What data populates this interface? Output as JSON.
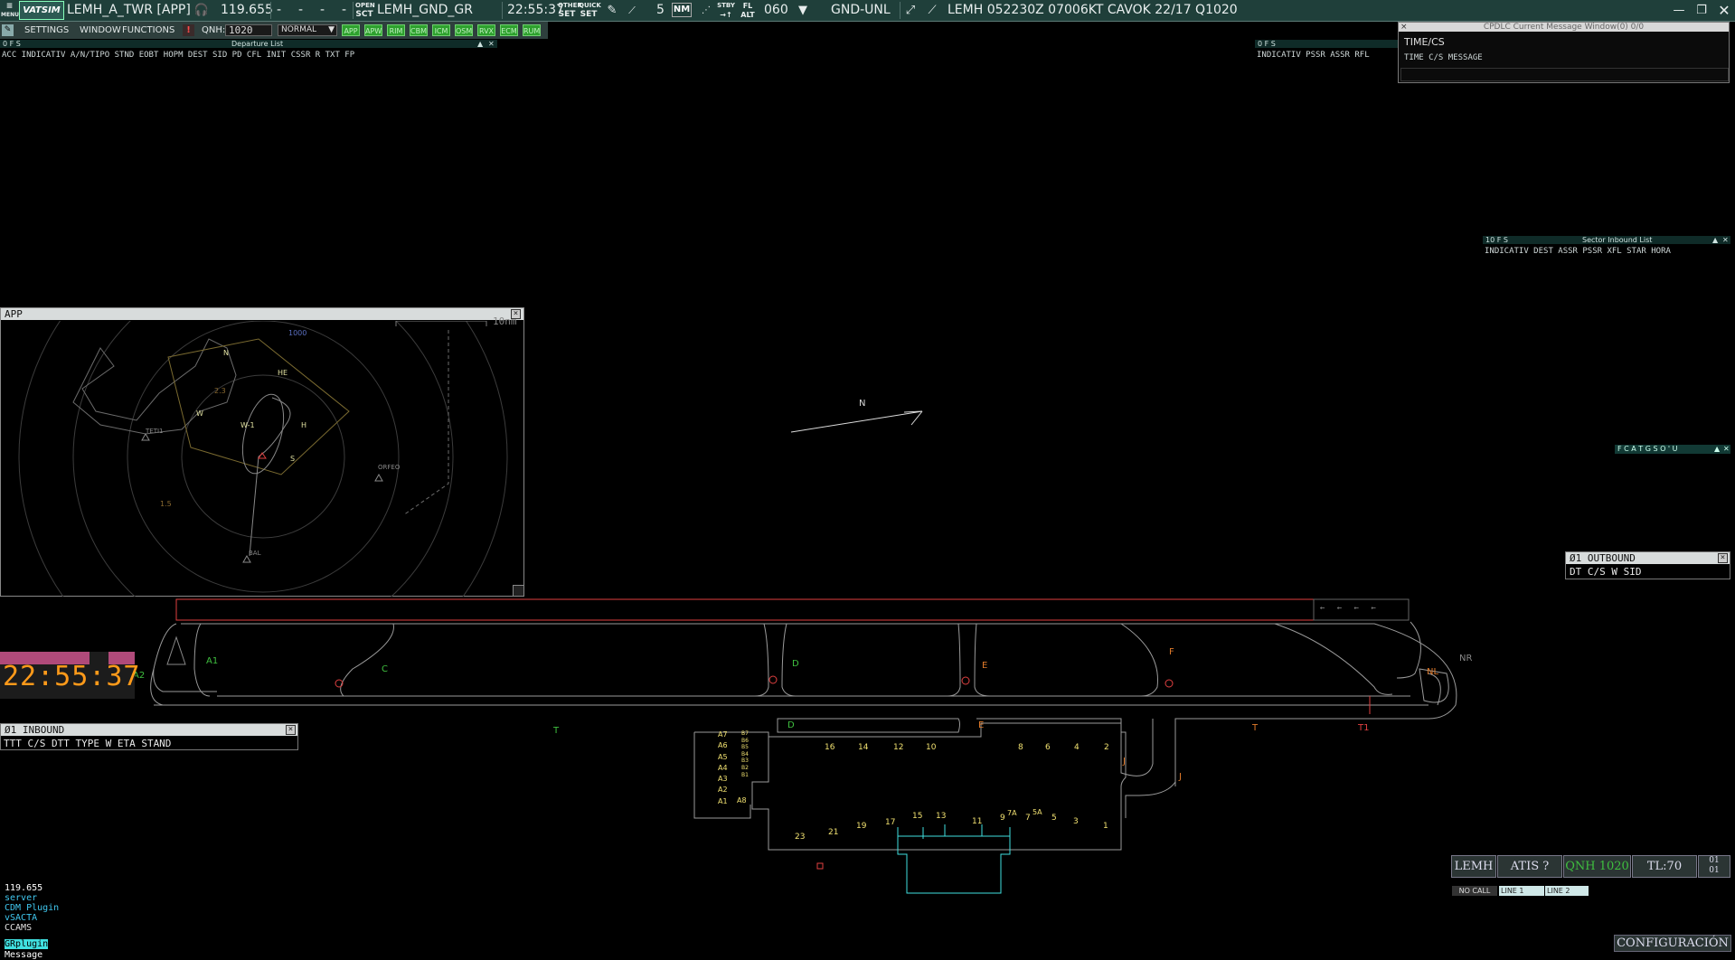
{
  "topbar": {
    "menu_label": "MENU",
    "logo": "VATSIM",
    "callsign": "LEMH_A_TWR [APP]",
    "frequency": "119.655",
    "dashes": [
      "-",
      "-",
      "-",
      "-"
    ],
    "open_label": "OPEN",
    "sct_label": "SCT",
    "gnd_station": "LEMH_GND_GR",
    "utc_time": "22:55:37",
    "other_set": "OTHER",
    "set_label": "SET",
    "quick_set": "QUICK",
    "range_value": "5",
    "nm_label": "NM",
    "stby_label": "STBY",
    "fl_label": "FL",
    "alt_label": "ALT",
    "fl_value": "060",
    "gnd_unl": "GND-UNL",
    "metar": "LEMH 052230Z 07006KT CAVOK 22/17 Q1020"
  },
  "bar2": {
    "settings": "SETTINGS",
    "window": "WINDOW",
    "functions": "FUNCTIONS",
    "qnh_label": "QNH:",
    "qnh_value": "1020",
    "mode": "NORMAL",
    "green_buttons": [
      "APP",
      "APW",
      "RIM",
      "CBM",
      "ICM",
      "OSM",
      "RVX",
      "ECM",
      "RUM"
    ]
  },
  "departure_list": {
    "title": "Departure List",
    "flags": "0 F S",
    "columns": "ACC INDICATIV A/N/TIPO STND  EOBT  HOPM  DEST    SID      PD    CFL   INIT  CSSR  R          TXT            FP"
  },
  "small_list": {
    "flags": "0 F S",
    "columns": "INDICATIV PSSR  ASSR   RFL"
  },
  "cpdlc": {
    "title": "CPDLC Current Message Window(0) 0/0",
    "time_cs": "TIME/CS",
    "columns": "TIME   C/S              MESSAGE"
  },
  "sector_inbound": {
    "flags": "10 F S",
    "title": "Sector Inbound List",
    "columns": "INDICATIV DEST  ASSR PSSR  XFL    STAR   HORA"
  },
  "app_window": {
    "title": "APP",
    "scale": "10nm",
    "alt_label": "1000",
    "labels": [
      "N",
      "HE",
      "W",
      "W-1",
      "H",
      "S",
      "2.3",
      "1.5",
      "TETI1",
      "ORFEO",
      "BAL"
    ]
  },
  "north_marker": "N",
  "fcat_label": "F C A T G S O ' U",
  "outbound": {
    "title": "Ø1 OUTBOUND",
    "columns": "DT    C/S         W SID"
  },
  "inbound": {
    "title": "Ø1 INBOUND",
    "columns": "TTT    C/S          DTT TYPE W ETA    STAND"
  },
  "clock": {
    "time": "22:55:37"
  },
  "airport": {
    "taxiway_labels": [
      "A1",
      "A2",
      "C",
      "D",
      "E",
      "F",
      "NL",
      "NR",
      "T",
      "T",
      "T1",
      "D",
      "E",
      "J",
      "J"
    ],
    "stands_left": [
      "A7",
      "A6",
      "A5",
      "A4",
      "A3",
      "A2",
      "A1",
      "A8"
    ],
    "stands_right_col": [
      "B7",
      "B6",
      "B5",
      "B4",
      "B3",
      "B2",
      "B1"
    ],
    "stands_top": [
      "16",
      "14",
      "12",
      "10",
      "8",
      "6",
      "4",
      "2"
    ],
    "stands_bottom": [
      "23",
      "21",
      "19",
      "17",
      "15",
      "13",
      "11",
      "9",
      "7A",
      "7",
      "5A",
      "5",
      "3",
      "1"
    ],
    "arrows": "← ← ← ←"
  },
  "status": {
    "airport": "LEMH",
    "atis": "ATIS ?",
    "qnh": "QNH 1020",
    "tl": "TL:70",
    "count_top": "01",
    "count_bottom": "01",
    "no_call": "NO CALL",
    "line1": "LINE 1",
    "line2": "LINE 2"
  },
  "message_area": {
    "lines": [
      "119.655",
      "server",
      "CDM Plugin",
      "vSACTA",
      "CCAMS",
      "GRplugin",
      "Message"
    ]
  },
  "config_button": "CONFIGURACIÓN",
  "colors": {
    "topbar_bg": "#1f3f3a",
    "green_btn": "#2ea12e",
    "clock_orange": "#ff9a1a",
    "runway_red": "#e04040",
    "taxiway_label_green": "#3fbf3f",
    "taxiway_label_orange": "#e07a2a",
    "stand_yellow": "#f0e070",
    "terminal_cyan": "#40e0e0"
  }
}
